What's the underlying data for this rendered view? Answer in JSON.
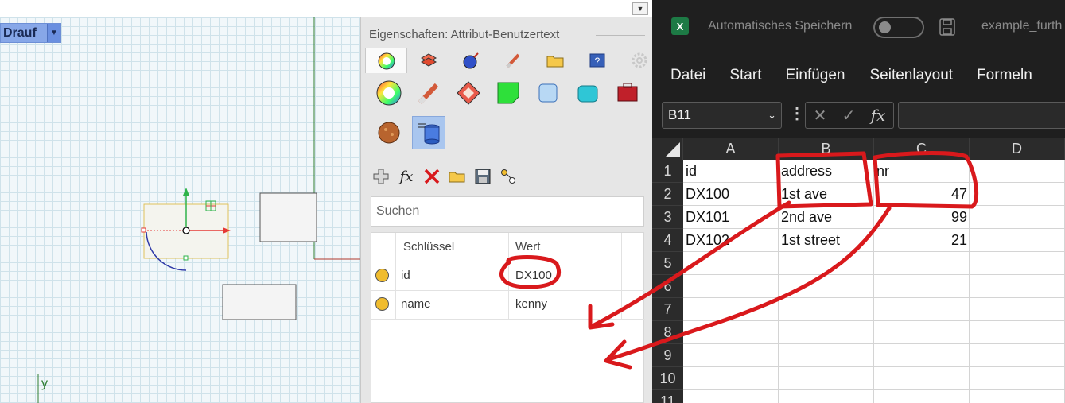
{
  "rhino": {
    "view_label": "Drauf",
    "axis_label": "y"
  },
  "properties": {
    "title": "Eigenschaften: Attribut-Benutzertext",
    "tabs": [
      {
        "icon": "color-wheel-icon"
      },
      {
        "icon": "layer-icon"
      },
      {
        "icon": "render-icon"
      },
      {
        "icon": "material-paint-icon"
      },
      {
        "icon": "folder-icon"
      },
      {
        "icon": "help-icon"
      },
      {
        "icon": "settings-icon"
      }
    ],
    "toolbar": [
      "add-icon",
      "function-icon",
      "delete-icon",
      "open-folder-icon",
      "save-icon",
      "link-icon"
    ],
    "search_placeholder": "Suchen",
    "table": {
      "columns": [
        "Schlüssel",
        "Wert"
      ],
      "rows": [
        {
          "key": "id",
          "value": "DX100"
        },
        {
          "key": "name",
          "value": "kenny"
        }
      ]
    }
  },
  "excel": {
    "autosave_label": "Automatisches Speichern",
    "filename": "example_furth",
    "ribbon_tabs": [
      "Datei",
      "Start",
      "Einfügen",
      "Seitenlayout",
      "Formeln"
    ],
    "name_box": "B11",
    "fx_label": "fx",
    "columns": [
      "A",
      "B",
      "C",
      "D"
    ],
    "rows": [
      "1",
      "2",
      "3",
      "4",
      "5",
      "6",
      "7",
      "8",
      "9",
      "10",
      "11"
    ],
    "cells": [
      [
        "id",
        "address",
        "nr",
        ""
      ],
      [
        "DX100",
        "1st ave",
        "47",
        ""
      ],
      [
        "DX101",
        "2nd ave",
        "99",
        ""
      ],
      [
        "DX102",
        "1st street",
        "21",
        ""
      ]
    ]
  },
  "colors": {
    "annotation": "#d9191c",
    "excel_green": "#1d7a45",
    "selection_blue": "#a9c6ef"
  }
}
